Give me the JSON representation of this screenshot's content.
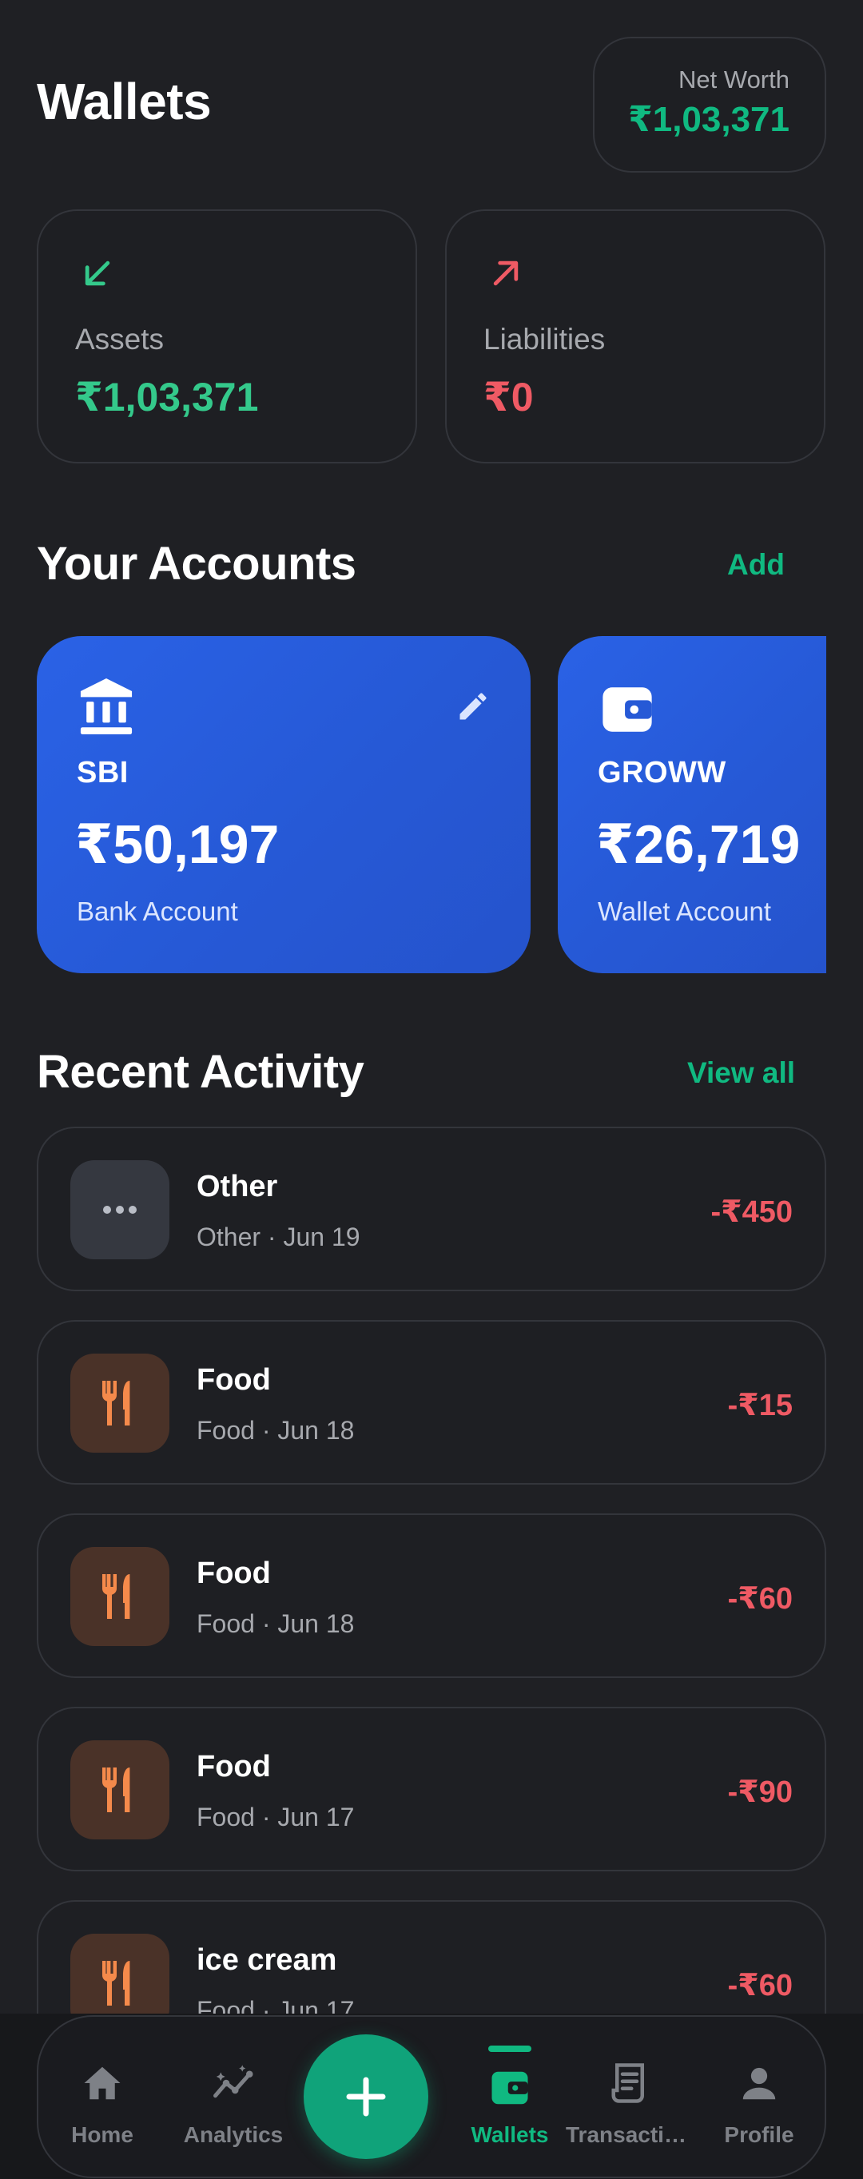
{
  "header": {
    "title": "Wallets",
    "net_worth_label": "Net Worth",
    "net_worth_value": "₹1,03,371"
  },
  "summary": {
    "assets": {
      "label": "Assets",
      "value": "₹1,03,371",
      "icon": "arrow-down-left-icon",
      "color": "#34c98b"
    },
    "liabilities": {
      "label": "Liabilities",
      "value": "₹0",
      "icon": "arrow-up-right-icon",
      "color": "#ef5a64"
    }
  },
  "accounts_section": {
    "title": "Your Accounts",
    "add_label": "Add",
    "accounts": [
      {
        "name": "SBI",
        "balance": "₹50,197",
        "type": "Bank Account",
        "icon": "bank-icon"
      },
      {
        "name": "GROWW",
        "balance": "₹26,719",
        "type": "Wallet Account",
        "icon": "wallet-icon"
      }
    ]
  },
  "activity_section": {
    "title": "Recent Activity",
    "view_all_label": "View all",
    "items": [
      {
        "title": "Other",
        "subtitle": "Other · Jun 19",
        "amount": "-₹450",
        "icon": "more-dots-icon"
      },
      {
        "title": "Food",
        "subtitle": "Food · Jun 18",
        "amount": "-₹15",
        "icon": "fork-knife-icon"
      },
      {
        "title": "Food",
        "subtitle": "Food · Jun 18",
        "amount": "-₹60",
        "icon": "fork-knife-icon"
      },
      {
        "title": "Food",
        "subtitle": "Food · Jun 17",
        "amount": "-₹90",
        "icon": "fork-knife-icon"
      },
      {
        "title": "ice cream",
        "subtitle": "Food · Jun 17",
        "amount": "-₹60",
        "icon": "fork-knife-icon"
      }
    ]
  },
  "nav": {
    "items": [
      {
        "label": "Home",
        "icon": "home-icon",
        "active": false
      },
      {
        "label": "Analytics",
        "icon": "analytics-icon",
        "active": false
      },
      {
        "label": "Wallets",
        "icon": "wallet-icon",
        "active": true
      },
      {
        "label": "Transactio...",
        "icon": "receipt-icon",
        "active": false
      },
      {
        "label": "Profile",
        "icon": "person-icon",
        "active": false
      }
    ],
    "add_button_icon": "plus-icon"
  },
  "colors": {
    "accent": "#10b981",
    "negative": "#ef5a64",
    "card_blue": "#2a62e6",
    "background": "#1f2024"
  }
}
